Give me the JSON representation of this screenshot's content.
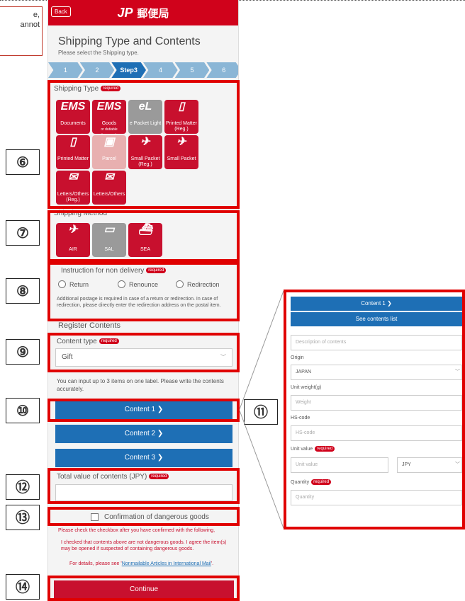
{
  "note": {
    "text": "e,\nannot"
  },
  "header": {
    "back_label": "Back",
    "logo_mark": "JP",
    "logo_text": "郵便局",
    "logo_sub": "POST"
  },
  "page": {
    "title": "Shipping Type and Contents",
    "subtitle": "Please select the Shipping type."
  },
  "steps": [
    "1",
    "2",
    "Step3",
    "4",
    "5",
    "6"
  ],
  "shipping_type": {
    "label": "Shipping Type",
    "required": "required",
    "tiles": [
      {
        "icon": "EMS",
        "label": "Documents"
      },
      {
        "icon": "EMS",
        "label": "Goods",
        "sub": "or dutiable documents"
      },
      {
        "icon": "eL",
        "label": "e Packet Light"
      },
      {
        "icon": "▯",
        "label": "Printed Matter",
        "sub": "(Reg.)"
      },
      {
        "icon": "▯",
        "label": "Printed Matter"
      },
      {
        "icon": "▣",
        "label": "Parcel"
      },
      {
        "icon": "✈",
        "label": "Small Packet",
        "sub": "(Reg.)"
      },
      {
        "icon": "✈",
        "label": "Small Packet"
      },
      {
        "icon": "✉",
        "label": "Letters/Others",
        "sub": "(Reg.)"
      },
      {
        "icon": "✉",
        "label": "Letters/Others"
      }
    ]
  },
  "shipping_method": {
    "label": "Shipping Method",
    "tiles": [
      {
        "label": "AIR"
      },
      {
        "label": "SAL"
      },
      {
        "label": "SEA"
      }
    ]
  },
  "non_delivery": {
    "label": "Instruction for non delivery",
    "required": "required",
    "options": [
      "Return",
      "Renounce",
      "Redirection"
    ],
    "note": "Additional postage is required in case of a return or redirection. In case of redirection, please directly enter the redirection address on the postal item."
  },
  "register": {
    "title": "Register Contents"
  },
  "content_type": {
    "label": "Content type",
    "required": "required",
    "value": "Gift",
    "hint": "You can input up to 3 items on one label. Please write the contents accurately."
  },
  "contents": [
    "Content 1 ❯",
    "Content 2 ❯",
    "Content 3 ❯"
  ],
  "total": {
    "label": "Total value of contents (JPY)",
    "required": "required"
  },
  "danger": {
    "label": "Confirmation of dangerous goods",
    "warn": "Please check the checkbox after you have confirmed with the following,",
    "statement": "I checked that contents above are not dangerous goods. I agree the item(s) may be opened if suspected of containing dangerous goods.",
    "details_prefix": "For details, please see '",
    "details_link": "Nonmailable Articles in International Mail",
    "details_suffix": "'."
  },
  "continue_label": "Continue",
  "callouts": [
    "⑥",
    "⑦",
    "⑧",
    "⑨",
    "⑩",
    "⑪",
    "⑫",
    "⑬",
    "⑭"
  ],
  "side_panel": {
    "header": "Content 1 ❯",
    "see_list": "See contents list",
    "description_placeholder": "Description of contents",
    "origin_label": "Origin",
    "origin_value": "JAPAN",
    "weight_label": "Unit weight(g)",
    "weight_placeholder": "Weight",
    "hs_label": "HS-code",
    "hs_placeholder": "HS-code",
    "value_label": "Unit value",
    "value_required": "required",
    "value_placeholder": "Unit value",
    "currency": "JPY",
    "qty_label": "Quantity",
    "qty_required": "required",
    "qty_placeholder": "Quantity"
  }
}
